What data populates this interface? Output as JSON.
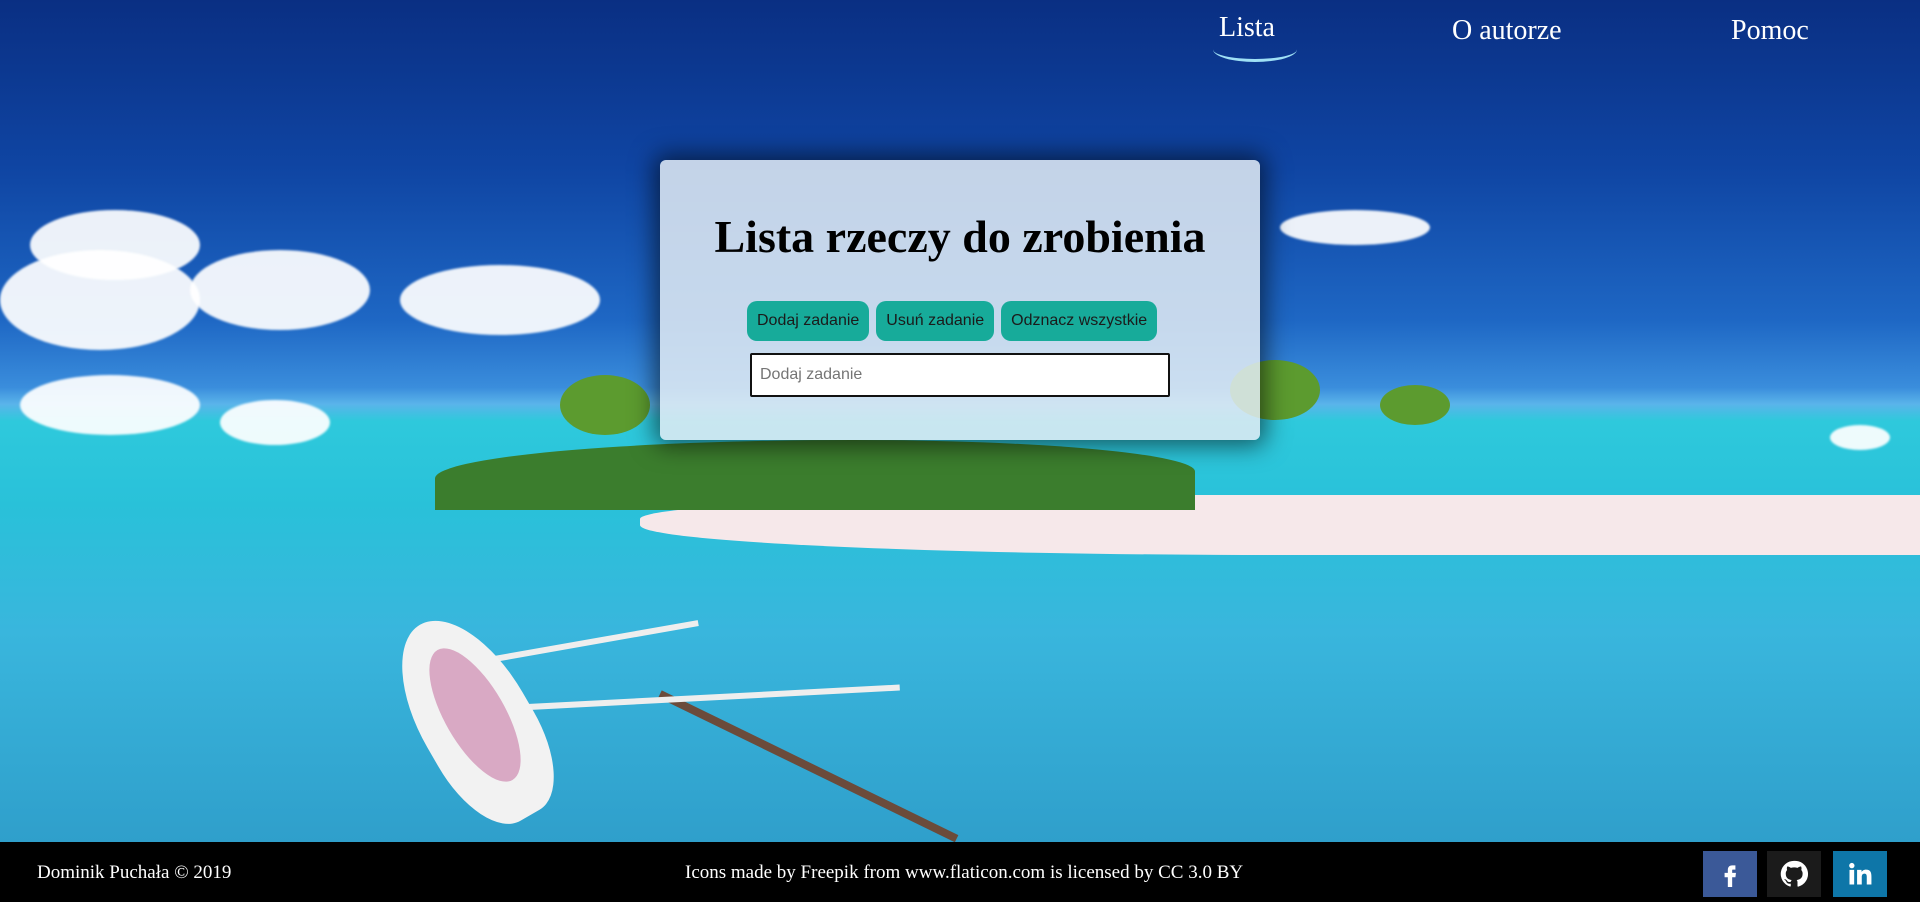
{
  "nav": {
    "items": [
      {
        "label": "Lista",
        "active": true
      },
      {
        "label": "O autorze",
        "active": false
      },
      {
        "label": "Pomoc",
        "active": false
      }
    ]
  },
  "card": {
    "title": "Lista rzeczy do zrobienia",
    "buttons": [
      "Dodaj zadanie",
      "Usuń zadanie",
      "Odznacz wszystkie"
    ],
    "input_placeholder": "Dodaj zadanie",
    "input_value": ""
  },
  "footer": {
    "copyright": "Dominik Puchała © 2019",
    "credit": "Icons made by Freepik from www.flaticon.com is licensed by CC 3.0 BY",
    "social": [
      {
        "icon": "facebook-icon",
        "color": "#3b5998"
      },
      {
        "icon": "github-icon",
        "color": "#1b1b1b"
      },
      {
        "icon": "linkedin-icon",
        "color": "#0e76a8"
      }
    ]
  },
  "colors": {
    "accent_button": "#17ab9a",
    "nav_underline": "#9fe0f5"
  }
}
